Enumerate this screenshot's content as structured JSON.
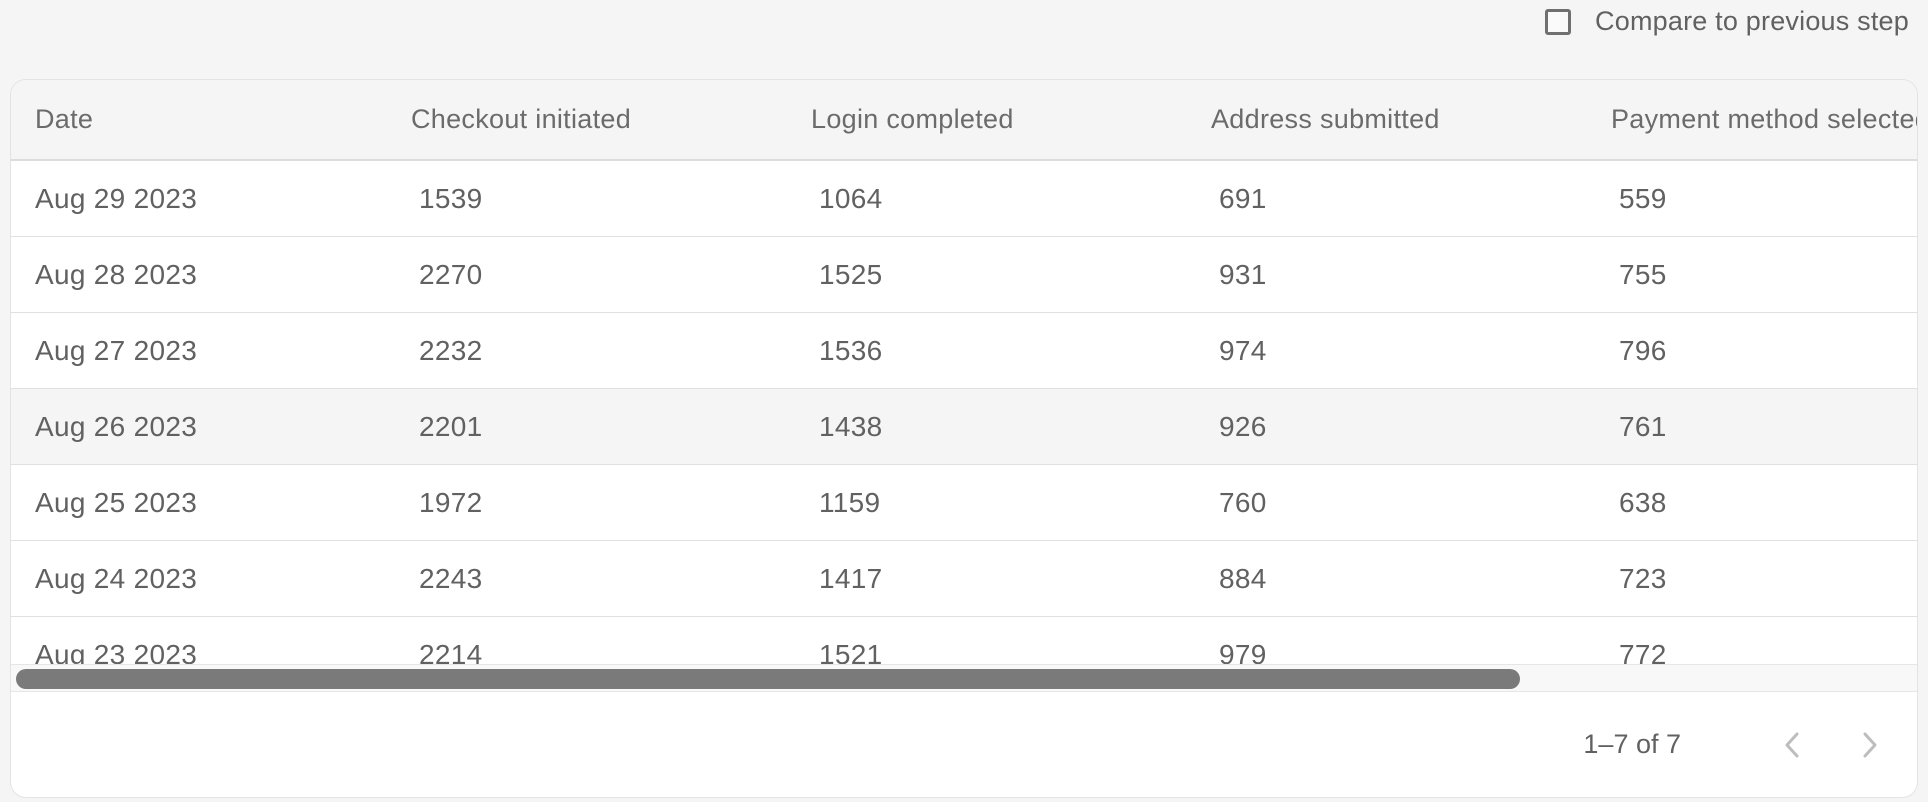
{
  "compare": {
    "label": "Compare to previous step",
    "checked": false
  },
  "table": {
    "columns": [
      "Date",
      "Checkout initiated",
      "Login completed",
      "Address submitted",
      "Payment method selected"
    ],
    "rows": [
      [
        "Aug 29 2023",
        "1539",
        "1064",
        "691",
        "559"
      ],
      [
        "Aug 28 2023",
        "2270",
        "1525",
        "931",
        "755"
      ],
      [
        "Aug 27 2023",
        "2232",
        "1536",
        "974",
        "796"
      ],
      [
        "Aug 26 2023",
        "2201",
        "1438",
        "926",
        "761"
      ],
      [
        "Aug 25 2023",
        "1972",
        "1159",
        "760",
        "638"
      ],
      [
        "Aug 24 2023",
        "2243",
        "1417",
        "884",
        "723"
      ],
      [
        "Aug 23 2023",
        "2214",
        "1521",
        "979",
        "772"
      ]
    ]
  },
  "pagination": {
    "label": "1–7 of 7",
    "prev_icon": "chevron-left-icon",
    "next_icon": "chevron-right-icon"
  }
}
